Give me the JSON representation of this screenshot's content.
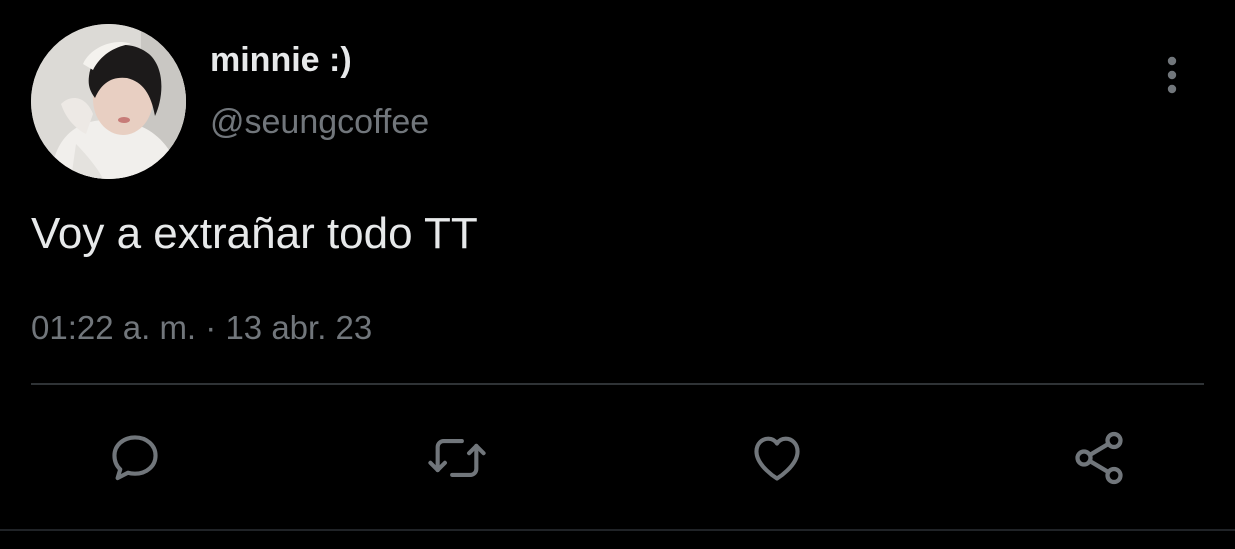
{
  "tweet": {
    "author": {
      "display_name": "minnie :)",
      "handle": "@seungcoffee"
    },
    "text": "Voy a extrañar todo TT",
    "time": "01:22 a. m.",
    "separator": "·",
    "date": "13 abr. 23"
  },
  "actions": [
    {
      "icon": "reply-icon"
    },
    {
      "icon": "retweet-icon"
    },
    {
      "icon": "like-icon"
    },
    {
      "icon": "share-icon"
    }
  ],
  "colors": {
    "background": "#000000",
    "primary_text": "#e7e9ea",
    "secondary_text": "#71767b",
    "divider": "#2f3336"
  }
}
